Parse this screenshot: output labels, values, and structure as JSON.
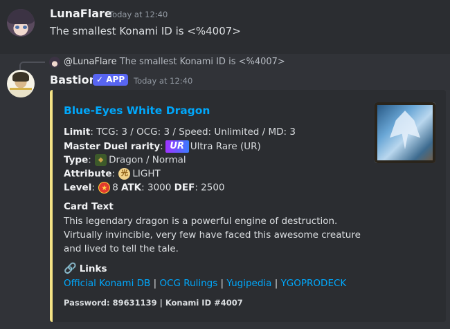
{
  "message1": {
    "username": "LunaFlare",
    "timestamp": "Today at 12:40",
    "content": "The smallest Konami ID is <%4007>"
  },
  "reply": {
    "mention": "@LunaFlare",
    "text": "The smallest Konami ID is <%4007>"
  },
  "message2": {
    "username": "Bastion",
    "badge": "✓ APP",
    "timestamp": "Today at 12:40"
  },
  "embed": {
    "accent_color": "#f4e285",
    "title": "Blue-Eyes White Dragon",
    "limit_label": "Limit",
    "limit_value": ": TCG: 3 / OCG: 3 / Speed: Unlimited / MD: 3",
    "rarity_label": "Master Duel rarity",
    "rarity_badge": "UR",
    "rarity_value": "Ultra Rare (UR)",
    "type_label": "Type",
    "type_icon": "dragon-type-icon",
    "type_value": "Dragon / Normal",
    "attribute_label": "Attribute",
    "attribute_icon_glyph": "光",
    "attribute_value": "LIGHT",
    "level_label": "Level",
    "level_icon_glyph": "★",
    "level_value": "8",
    "atk_label": "ATK",
    "atk_value": "3000",
    "def_label": "DEF",
    "def_value": "2500",
    "card_text_title": "Card Text",
    "card_text": "This legendary dragon is a powerful engine of destruction. Virtually invincible, very few have faced this awesome creature and lived to tell the tale.",
    "links_icon": "🔗",
    "links_title": "Links",
    "links": [
      "Official Konami DB",
      "OCG Rulings",
      "Yugipedia",
      "YGOPRODECK"
    ],
    "separator": " | ",
    "footer": "Password: 89631139 | Konami ID #4007"
  }
}
